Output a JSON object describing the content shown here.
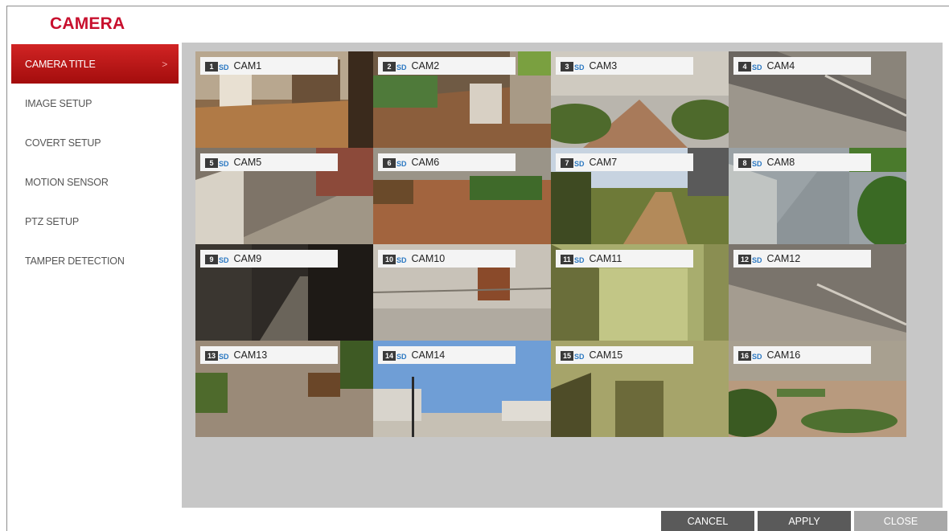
{
  "header": {
    "title": "CAMERA"
  },
  "sidebar": {
    "items": [
      {
        "label": "CAMERA TITLE",
        "active": true
      },
      {
        "label": "IMAGE SETUP"
      },
      {
        "label": "COVERT SETUP"
      },
      {
        "label": "MOTION SENSOR"
      },
      {
        "label": "PTZ SETUP"
      },
      {
        "label": "TAMPER DETECTION"
      }
    ],
    "active_chevron": ">"
  },
  "cameras": [
    {
      "num": "1",
      "quality": "SD",
      "name": "CAM1"
    },
    {
      "num": "2",
      "quality": "SD",
      "name": "CAM2"
    },
    {
      "num": "3",
      "quality": "SD",
      "name": "CAM3"
    },
    {
      "num": "4",
      "quality": "SD",
      "name": "CAM4"
    },
    {
      "num": "5",
      "quality": "SD",
      "name": "CAM5"
    },
    {
      "num": "6",
      "quality": "SD",
      "name": "CAM6"
    },
    {
      "num": "7",
      "quality": "SD",
      "name": "CAM7"
    },
    {
      "num": "8",
      "quality": "SD",
      "name": "CAM8"
    },
    {
      "num": "9",
      "quality": "SD",
      "name": "CAM9"
    },
    {
      "num": "10",
      "quality": "SD",
      "name": "CAM10"
    },
    {
      "num": "11",
      "quality": "SD",
      "name": "CAM11"
    },
    {
      "num": "12",
      "quality": "SD",
      "name": "CAM12"
    },
    {
      "num": "13",
      "quality": "SD",
      "name": "CAM13"
    },
    {
      "num": "14",
      "quality": "SD",
      "name": "CAM14"
    },
    {
      "num": "15",
      "quality": "SD",
      "name": "CAM15"
    },
    {
      "num": "16",
      "quality": "SD",
      "name": "CAM16"
    }
  ],
  "footer": {
    "cancel_label": "CANCEL",
    "apply_label": "APPLY",
    "close_label": "CLOSE"
  },
  "colors": {
    "brand_red": "#c8102e",
    "active_menu": "#b81616",
    "panel_gray": "#c7c7c7"
  }
}
